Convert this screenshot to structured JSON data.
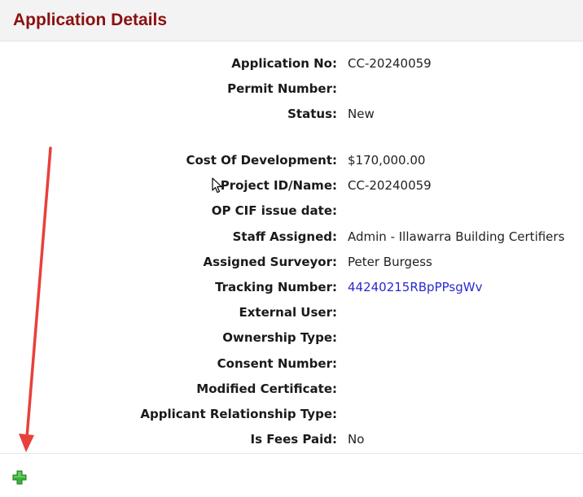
{
  "header": {
    "title": "Application Details"
  },
  "details": [
    {
      "label": "Application No:",
      "value": "CC-20240059"
    },
    {
      "label": "Permit Number:",
      "value": ""
    },
    {
      "label": "Status:",
      "value": "New"
    },
    {
      "label": "Cost Of Development:",
      "value": "$170,000.00"
    },
    {
      "label": "Project ID/Name:",
      "value": "CC-20240059"
    },
    {
      "label": "OP CIF issue date:",
      "value": ""
    },
    {
      "label": "Staff Assigned:",
      "value": "Admin - Illawarra Building Certifiers"
    },
    {
      "label": "Assigned Surveyor:",
      "value": "Peter Burgess"
    },
    {
      "label": "Tracking Number:",
      "value": "44240215RBpPPsgWv"
    },
    {
      "label": "External User:",
      "value": ""
    },
    {
      "label": "Ownership Type:",
      "value": ""
    },
    {
      "label": "Consent Number:",
      "value": ""
    },
    {
      "label": "Modified Certificate:",
      "value": ""
    },
    {
      "label": "Applicant Relationship Type:",
      "value": ""
    },
    {
      "label": "Is Fees Paid:",
      "value": "No"
    }
  ],
  "icons": {
    "add": "plus-icon",
    "cursor": "mouse-pointer-icon",
    "annotation": "red-arrow-icon"
  },
  "colors": {
    "title": "#8b1010",
    "link": "#2a2ad0",
    "add": "#3bb33b",
    "arrow": "#e8403a"
  }
}
